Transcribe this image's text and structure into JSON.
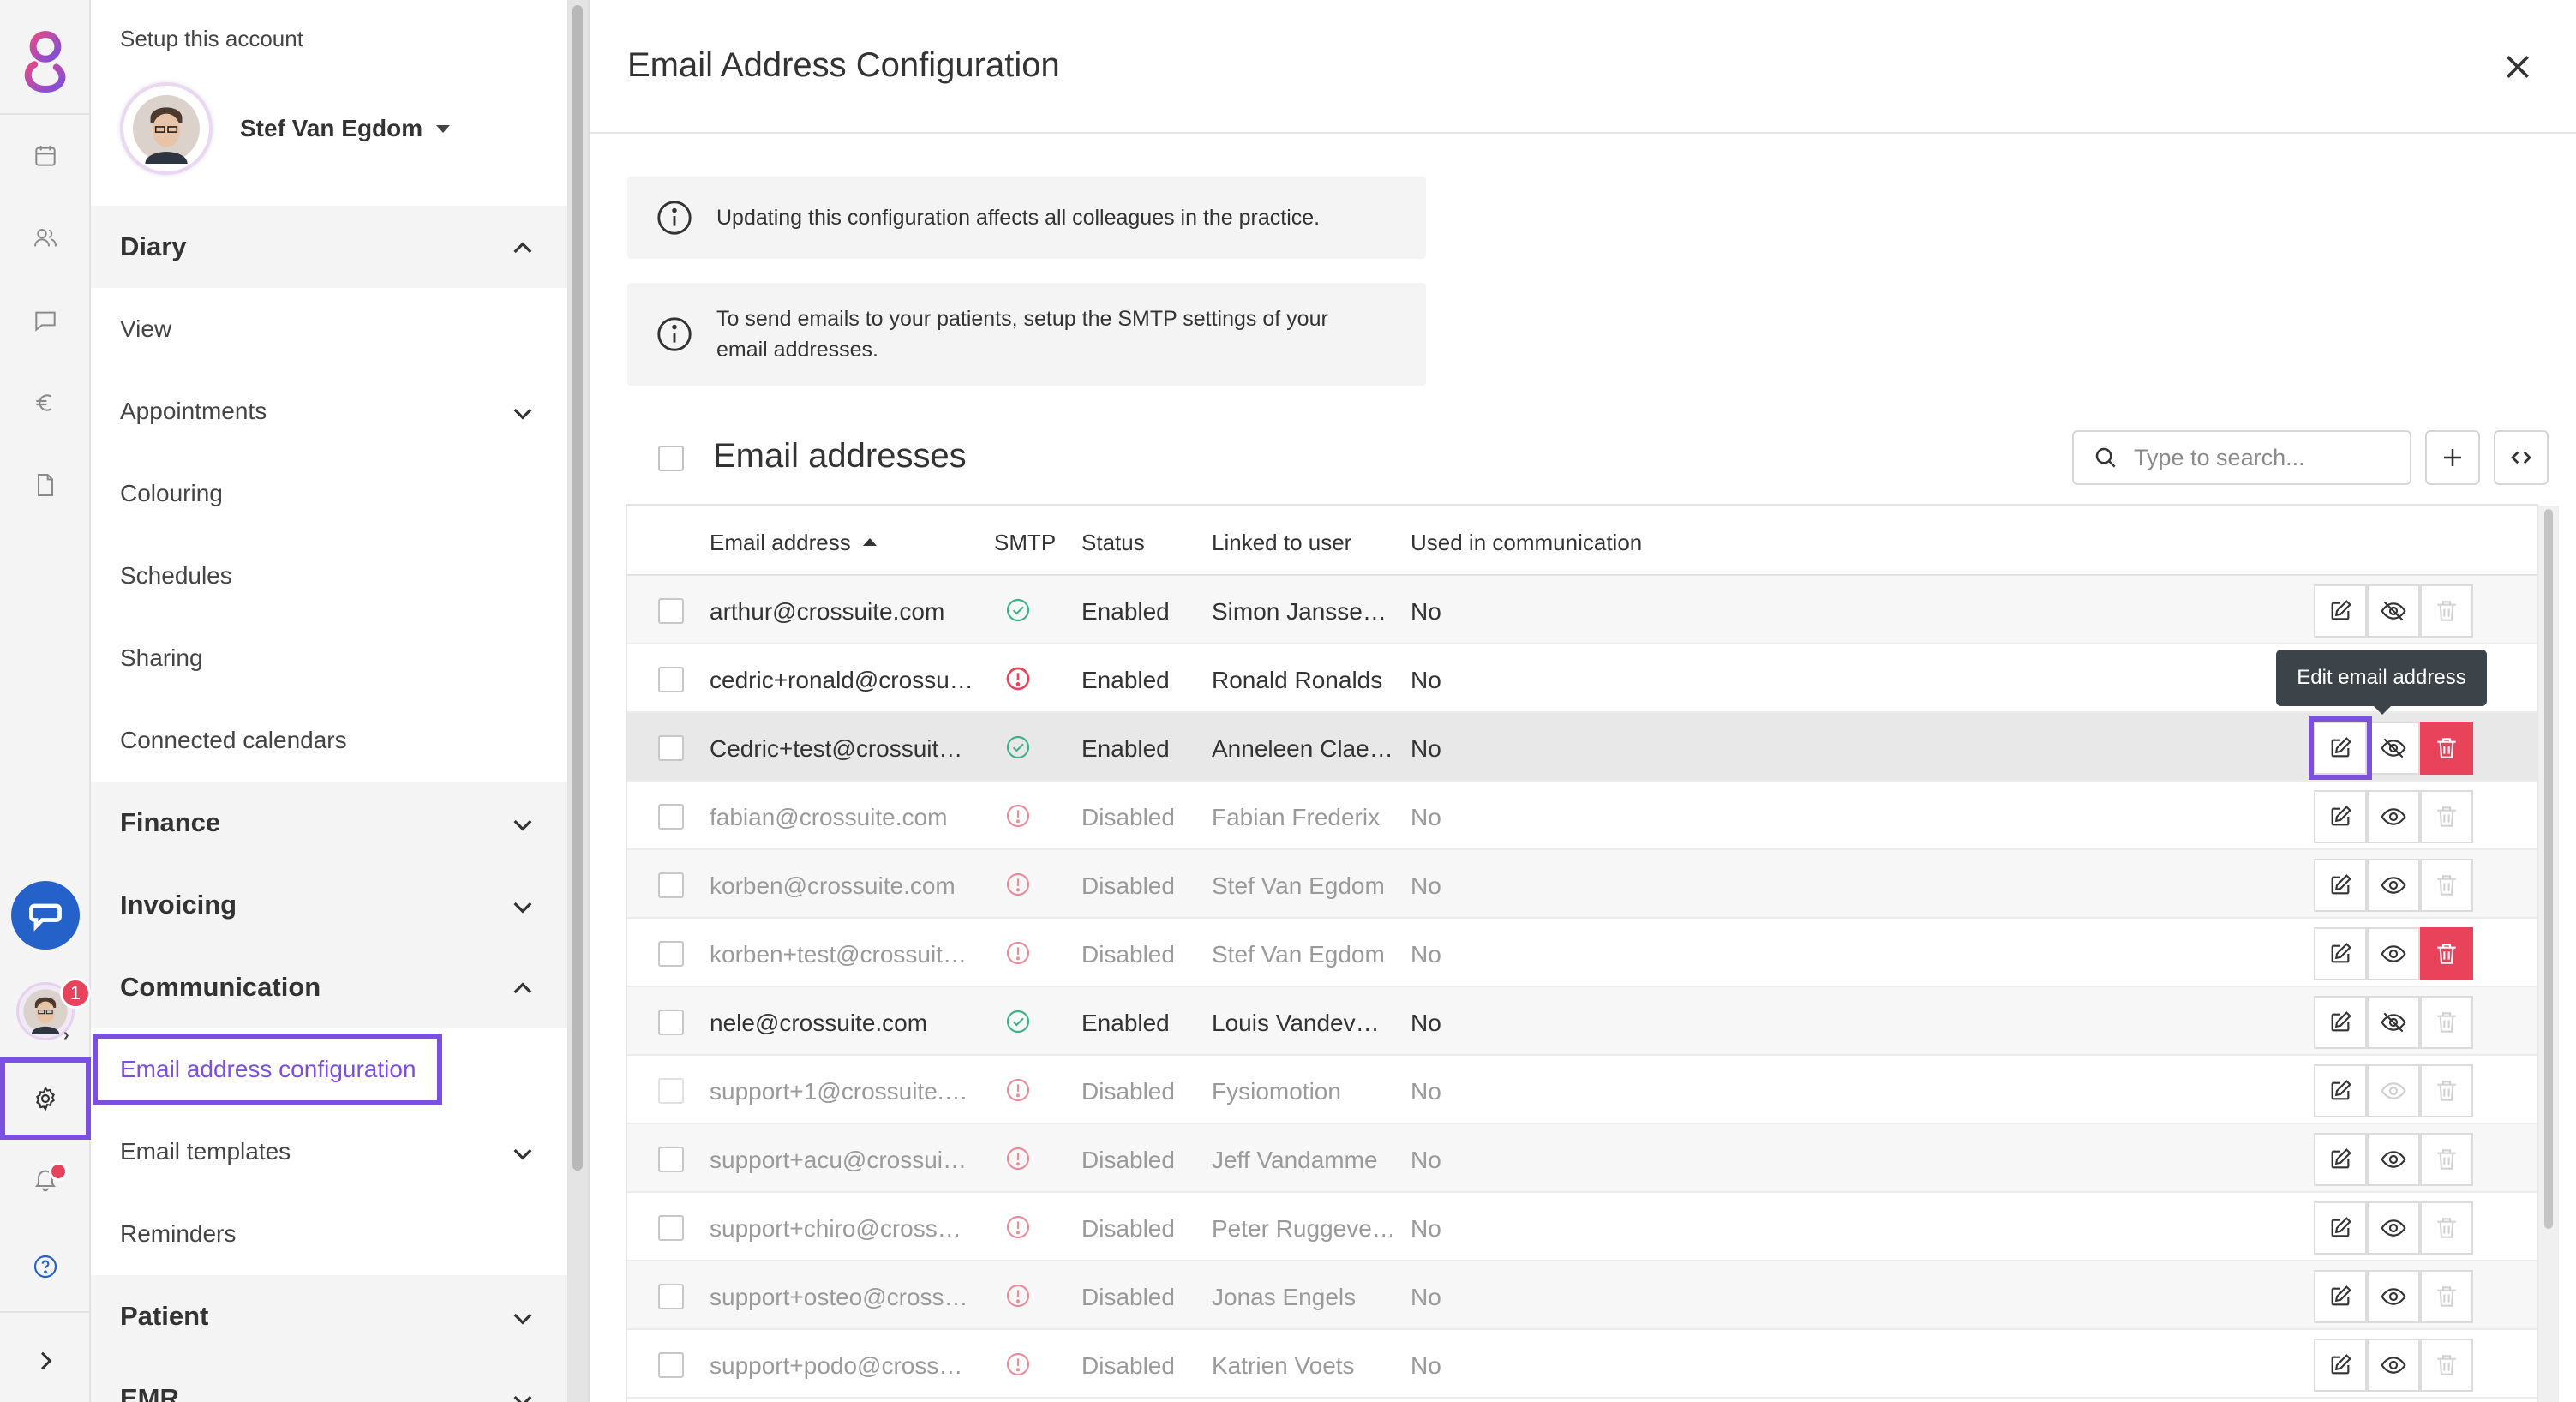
{
  "colors": {
    "accent": "#7b4fe0",
    "danger": "#e8435a",
    "success": "#3fb08a",
    "error": "#e8435a",
    "tooltip_bg": "#3c4449"
  },
  "rail": {
    "items": [
      {
        "name": "calendar-icon"
      },
      {
        "name": "users-icon"
      },
      {
        "name": "chat-icon"
      },
      {
        "name": "euro-icon"
      },
      {
        "name": "document-icon"
      }
    ],
    "notification_count": "1"
  },
  "nav": {
    "setup_title": "Setup this account",
    "user_name": "Stef Van Egdom",
    "sections": {
      "diary": "Diary",
      "diary_items": [
        "View",
        "Appointments",
        "Colouring",
        "Schedules",
        "Sharing",
        "Connected calendars"
      ],
      "finance": "Finance",
      "invoicing": "Invoicing",
      "communication": "Communication",
      "communication_items": [
        "Email address configuration",
        "Email templates",
        "Reminders"
      ],
      "patient": "Patient",
      "emr": "EMR"
    }
  },
  "main": {
    "title": "Email Address Configuration",
    "info1": "Updating this configuration affects all colleagues in the practice.",
    "info2_line1": "To send emails to your patients, setup the SMTP settings of your",
    "info2_line2": "email addresses.",
    "section_title": "Email addresses",
    "search_placeholder": "Type to search...",
    "tooltip": "Edit email address",
    "columns": [
      "Email address",
      "SMTP",
      "Status",
      "Linked to user",
      "Used in communication"
    ],
    "rows": [
      {
        "email": "arthur@crossuite.com",
        "smtp": "ok",
        "status": "Enabled",
        "user": "Simon Jansse…",
        "used": "No",
        "visibility": "hidden",
        "delete": "off"
      },
      {
        "email": "cedric+ronald@crossu…",
        "smtp": "error",
        "status": "Enabled",
        "user": "Ronald Ronalds",
        "used": "No",
        "visibility": "hidden",
        "delete": "off"
      },
      {
        "email": "Cedric+test@crossuit…",
        "smtp": "ok",
        "status": "Enabled",
        "user": "Anneleen Clae…",
        "used": "No",
        "visibility": "hidden",
        "delete": "on"
      },
      {
        "email": "fabian@crossuite.com",
        "smtp": "warn",
        "status": "Disabled",
        "user": "Fabian Frederix",
        "used": "No",
        "visibility": "visible",
        "delete": "off"
      },
      {
        "email": "korben@crossuite.com",
        "smtp": "warn",
        "status": "Disabled",
        "user": "Stef Van Egdom",
        "used": "No",
        "visibility": "visible",
        "delete": "off"
      },
      {
        "email": "korben+test@crossuit…",
        "smtp": "warn",
        "status": "Disabled",
        "user": "Stef Van Egdom",
        "used": "No",
        "visibility": "visible",
        "delete": "on"
      },
      {
        "email": "nele@crossuite.com",
        "smtp": "ok",
        "status": "Enabled",
        "user": "Louis Vandev…",
        "used": "No",
        "visibility": "hidden",
        "delete": "off"
      },
      {
        "email": "support+1@crossuite.…",
        "smtp": "warn",
        "status": "Disabled",
        "user": "Fysiomotion",
        "used": "No",
        "visibility": "faint",
        "delete": "off"
      },
      {
        "email": "support+acu@crossui…",
        "smtp": "warn",
        "status": "Disabled",
        "user": "Jeff Vandamme",
        "used": "No",
        "visibility": "visible",
        "delete": "off"
      },
      {
        "email": "support+chiro@cross…",
        "smtp": "warn",
        "status": "Disabled",
        "user": "Peter Ruggeve…",
        "used": "No",
        "visibility": "visible",
        "delete": "off"
      },
      {
        "email": "support+osteo@cross…",
        "smtp": "warn",
        "status": "Disabled",
        "user": "Jonas Engels",
        "used": "No",
        "visibility": "visible",
        "delete": "off"
      },
      {
        "email": "support+podo@cross…",
        "smtp": "warn",
        "status": "Disabled",
        "user": "Katrien Voets",
        "used": "No",
        "visibility": "visible",
        "delete": "off"
      }
    ]
  }
}
